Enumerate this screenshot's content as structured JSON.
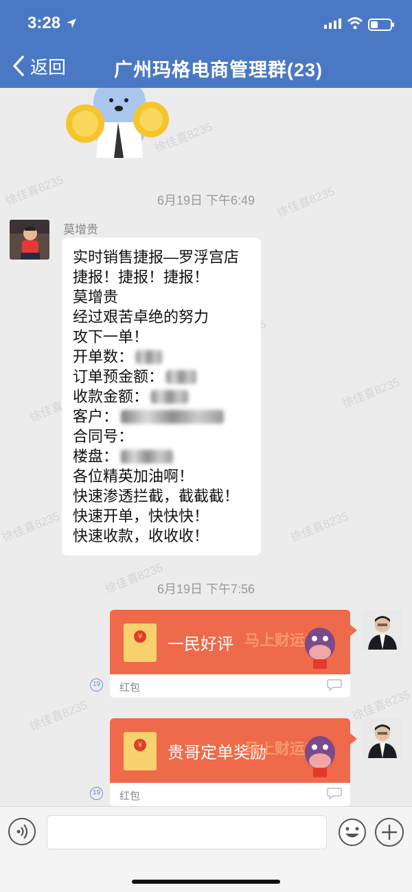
{
  "status_bar": {
    "time": "3:28"
  },
  "header": {
    "back_label": "返回",
    "title": "广州玛格电商管理群(23)"
  },
  "watermark": "徐佳喜8235",
  "messages": {
    "time1": "6月19日 下午6:49",
    "sender_name": "莫增贵",
    "lines": [
      "实时销售捷报—罗浮宫店",
      "捷报！捷报！捷报！",
      "莫增贵",
      "经过艰苦卓绝的努力",
      "攻下一单！",
      "开单数：",
      "订单预金额：",
      "收款金额：",
      "客户：",
      "合同号：",
      "楼盘：",
      "各位精英加油啊！",
      "快速渗透拦截，截截截！",
      "快速开单，快快快！",
      "快速收款，收收收！"
    ],
    "time2": "6月19日 下午7:56"
  },
  "red_packets": [
    {
      "message": "一民好评",
      "label": "红包",
      "deco": "马上财运来",
      "badge": "19"
    },
    {
      "message": "贵哥定单奖励",
      "label": "红包",
      "deco": "马上财运来",
      "badge": "19"
    }
  ],
  "colors": {
    "header_bg": "#4a78c4",
    "packet": "#ef6a4a",
    "chat_bg": "#ececec"
  },
  "icons": [
    "location-arrow-icon",
    "signal-icon",
    "wifi-icon",
    "battery-icon",
    "back-chevron-icon",
    "voice-icon",
    "emoji-icon",
    "plus-icon",
    "chat-bubble-icon"
  ]
}
